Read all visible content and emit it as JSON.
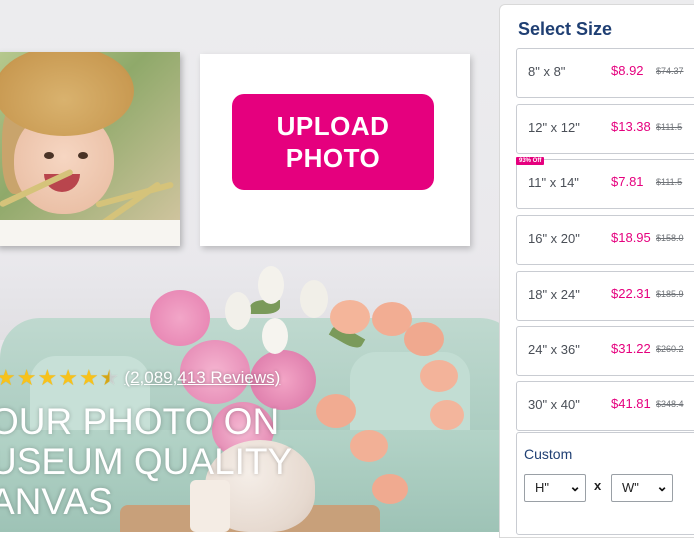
{
  "hero": {
    "upload_line1": "UPLOAD",
    "upload_line2": "PHOTO",
    "reviews_text": "(2,089,413 Reviews)",
    "rating": 4.5,
    "headline_line1": "OUR PHOTO ON",
    "headline_line2": "USEUM QUALITY",
    "headline_line3": "ANVAS"
  },
  "size_panel": {
    "title": "Select Size",
    "options": [
      {
        "label": "8\" x 8\"",
        "price": "$8.92",
        "old_price": "$74.37"
      },
      {
        "label": "12\" x 12\"",
        "price": "$13.38",
        "old_price": "$111.5"
      },
      {
        "label": "11\" x 14\"",
        "price": "$7.81",
        "old_price": "$111.5",
        "badge": "93% Off"
      },
      {
        "label": "16\" x 20\"",
        "price": "$18.95",
        "old_price": "$158.0"
      },
      {
        "label": "18\" x 24\"",
        "price": "$22.31",
        "old_price": "$185.9"
      },
      {
        "label": "24\" x 36\"",
        "price": "$31.22",
        "old_price": "$260.2"
      },
      {
        "label": "30\" x 40\"",
        "price": "$41.81",
        "old_price": "$348.4"
      }
    ],
    "custom": {
      "title": "Custom",
      "height_value": "H\"",
      "width_value": "W\"",
      "separator": "x"
    }
  },
  "colors": {
    "accent": "#e5007e",
    "title_blue": "#1f3f73",
    "star": "#f7c21b"
  }
}
